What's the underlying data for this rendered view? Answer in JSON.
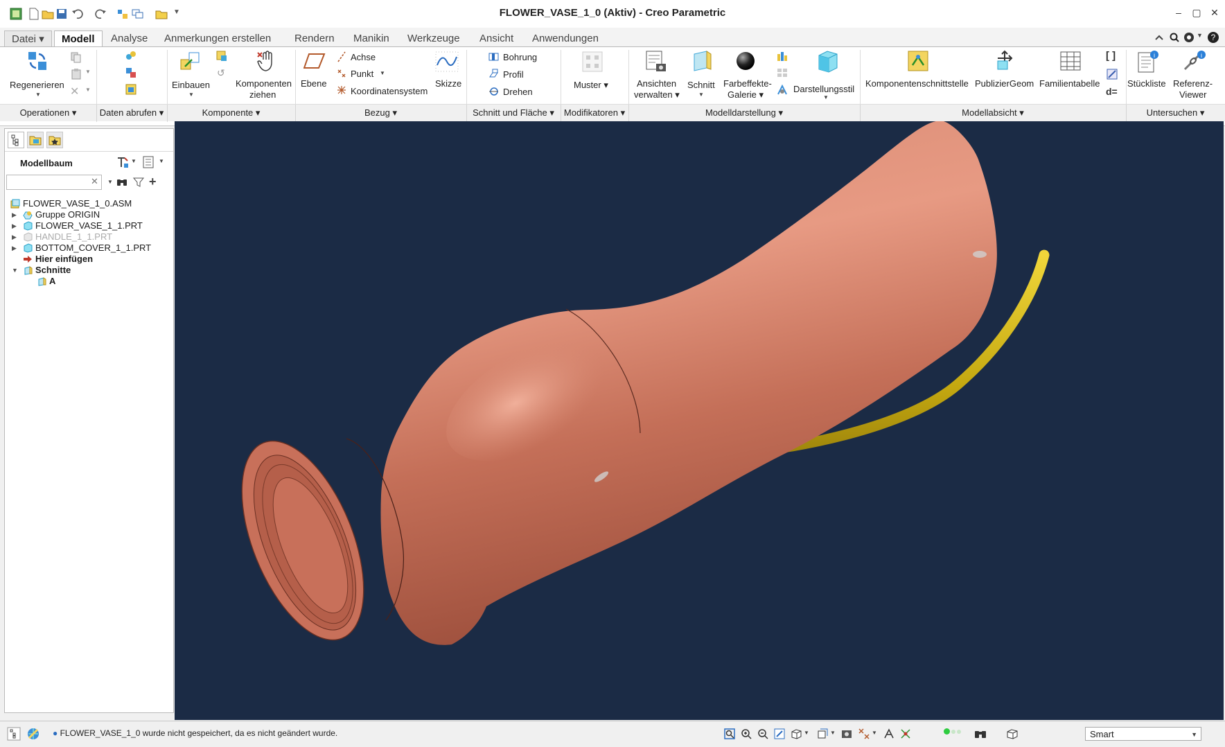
{
  "window": {
    "title": "FLOWER_VASE_1_0 (Aktiv) - Creo Parametric",
    "minimize": "‒",
    "maximize": "▢",
    "close": "✕"
  },
  "tabs": [
    {
      "label": "Datei"
    },
    {
      "label": "Modell"
    },
    {
      "label": "Analyse"
    },
    {
      "label": "Anmerkungen erstellen"
    },
    {
      "label": "Rendern"
    },
    {
      "label": "Manikin"
    },
    {
      "label": "Werkzeuge"
    },
    {
      "label": "Ansicht"
    },
    {
      "label": "Anwendungen"
    }
  ],
  "ribbon": {
    "regenerieren": "Regenerieren",
    "einbauen": "Einbauen",
    "komponenten_ziehen_1": "Komponenten",
    "komponenten_ziehen_2": "ziehen",
    "ebene": "Ebene",
    "achse": "Achse",
    "punkt": "Punkt",
    "koordinatensystem": "Koordinatensystem",
    "skizze": "Skizze",
    "bohrung": "Bohrung",
    "profil": "Profil",
    "drehen": "Drehen",
    "muster": "Muster",
    "ansichten_1": "Ansichten",
    "ansichten_2": "verwalten",
    "schnitt": "Schnitt",
    "farbeffekte_1": "Farbeffekte-",
    "farbeffekte_2": "Galerie",
    "darstellungsstil": "Darstellungsstil",
    "komponentenschnittstelle": "Komponentenschnittstelle",
    "publiziergeom": "PublizierGeom",
    "familientabelle": "Familientabelle",
    "stueckliste": "Stückliste",
    "referenz_1": "Referenz-",
    "referenz_2": "Viewer"
  },
  "groups": [
    {
      "label": "Operationen"
    },
    {
      "label": "Daten abrufen"
    },
    {
      "label": "Komponente"
    },
    {
      "label": "Bezug"
    },
    {
      "label": "Schnitt und Fläche"
    },
    {
      "label": "Modifikatoren"
    },
    {
      "label": "Modelldarstellung"
    },
    {
      "label": "Modellabsicht"
    },
    {
      "label": "Untersuchen"
    }
  ],
  "model_tree": {
    "title": "Modellbaum",
    "search_value": "",
    "items": [
      {
        "label": "FLOWER_VASE_1_0.ASM",
        "bold": false,
        "greyed": false
      },
      {
        "label": "Gruppe ORIGIN",
        "bold": false,
        "greyed": false
      },
      {
        "label": "FLOWER_VASE_1_1.PRT",
        "bold": false,
        "greyed": false
      },
      {
        "label": "HANDLE_1_1.PRT",
        "bold": false,
        "greyed": true
      },
      {
        "label": "BOTTOM_COVER_1_1.PRT",
        "bold": false,
        "greyed": false
      },
      {
        "label": "Hier einfügen",
        "bold": true,
        "greyed": false
      },
      {
        "label": "Schnitte",
        "bold": true,
        "greyed": false
      },
      {
        "label": "A",
        "bold": true,
        "greyed": false
      }
    ]
  },
  "status": {
    "message": "FLOWER_VASE_1_0 wurde nicht gespeichert, da es nicht geändert wurde.",
    "filter": "Smart"
  },
  "colors": {
    "viewport_bg": "#1b2b45",
    "vase": "#c8705a",
    "handle": "#b89a10"
  }
}
